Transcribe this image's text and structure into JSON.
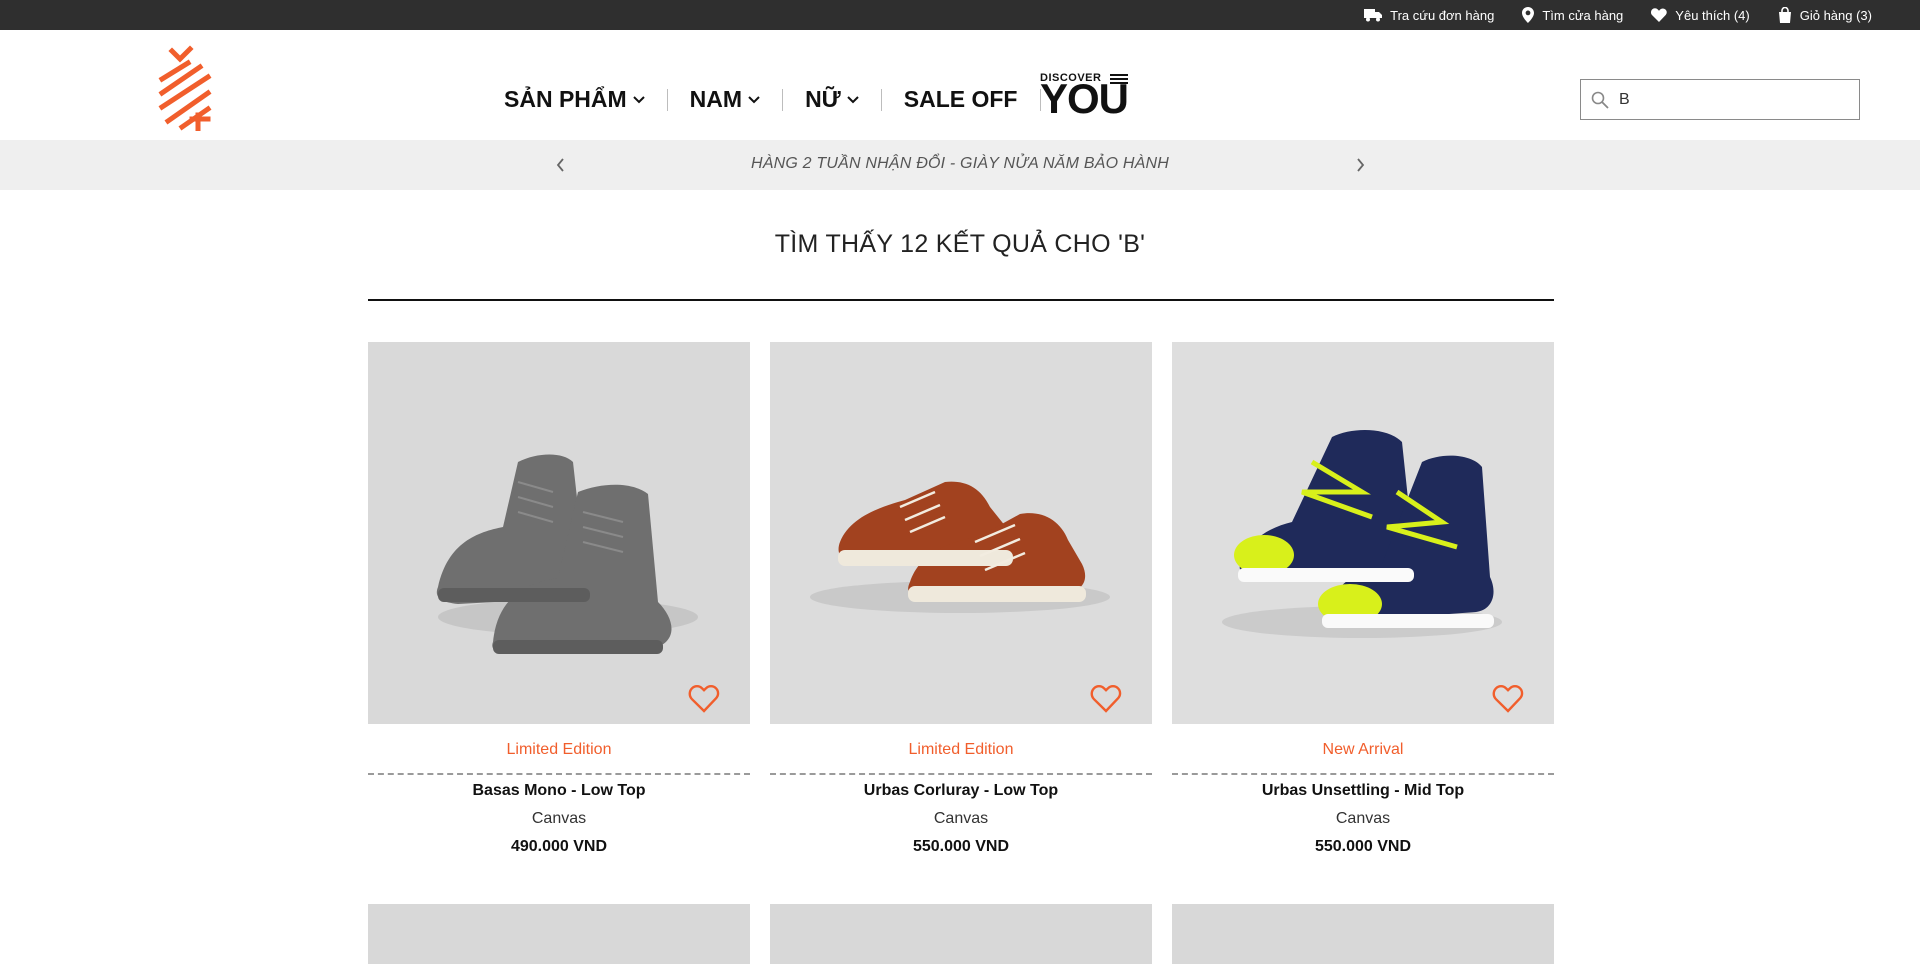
{
  "topbar": {
    "links": [
      {
        "label": "Tra cứu đơn hàng",
        "icon": "truck-icon"
      },
      {
        "label": "Tìm cửa hàng",
        "icon": "map-pin-icon"
      },
      {
        "label": "Yêu thích (4)",
        "icon": "heart-icon"
      },
      {
        "label": "Giỏ hàng (3)",
        "icon": "shopping-bag-icon"
      }
    ]
  },
  "nav": {
    "items": [
      {
        "label": "SẢN PHẨM",
        "has_dropdown": true
      },
      {
        "label": "NAM",
        "has_dropdown": true
      },
      {
        "label": "NỮ",
        "has_dropdown": true
      },
      {
        "label": "SALE OFF",
        "has_dropdown": false
      }
    ],
    "discover_small": "DISCOVER",
    "discover_big": "YOU"
  },
  "search": {
    "value": "B",
    "icon": "search-icon"
  },
  "announcement": {
    "text": "HÀNG 2 TUẦN NHẬN ĐỔI - GIÀY NỬA NĂM BẢO HÀNH"
  },
  "results": {
    "title": "TÌM THẤY 12 KẾT QUẢ CHO 'B'"
  },
  "products": [
    {
      "badge": "Limited Edition",
      "name": "Basas Mono - Low Top",
      "material": "Canvas",
      "price": "490.000 VND",
      "color": "#6e6e6e"
    },
    {
      "badge": "Limited Edition",
      "name": "Urbas Corluray - Low Top",
      "material": "Canvas",
      "price": "550.000 VND",
      "color": "#a2421f"
    },
    {
      "badge": "New Arrival",
      "name": "Urbas Unsettling - Mid Top",
      "material": "Canvas",
      "price": "550.000 VND",
      "color": "#1f2a5a"
    }
  ],
  "colors": {
    "accent": "#f15e2c",
    "topbar": "#2f2f2f",
    "announce_bg": "#efefef"
  }
}
